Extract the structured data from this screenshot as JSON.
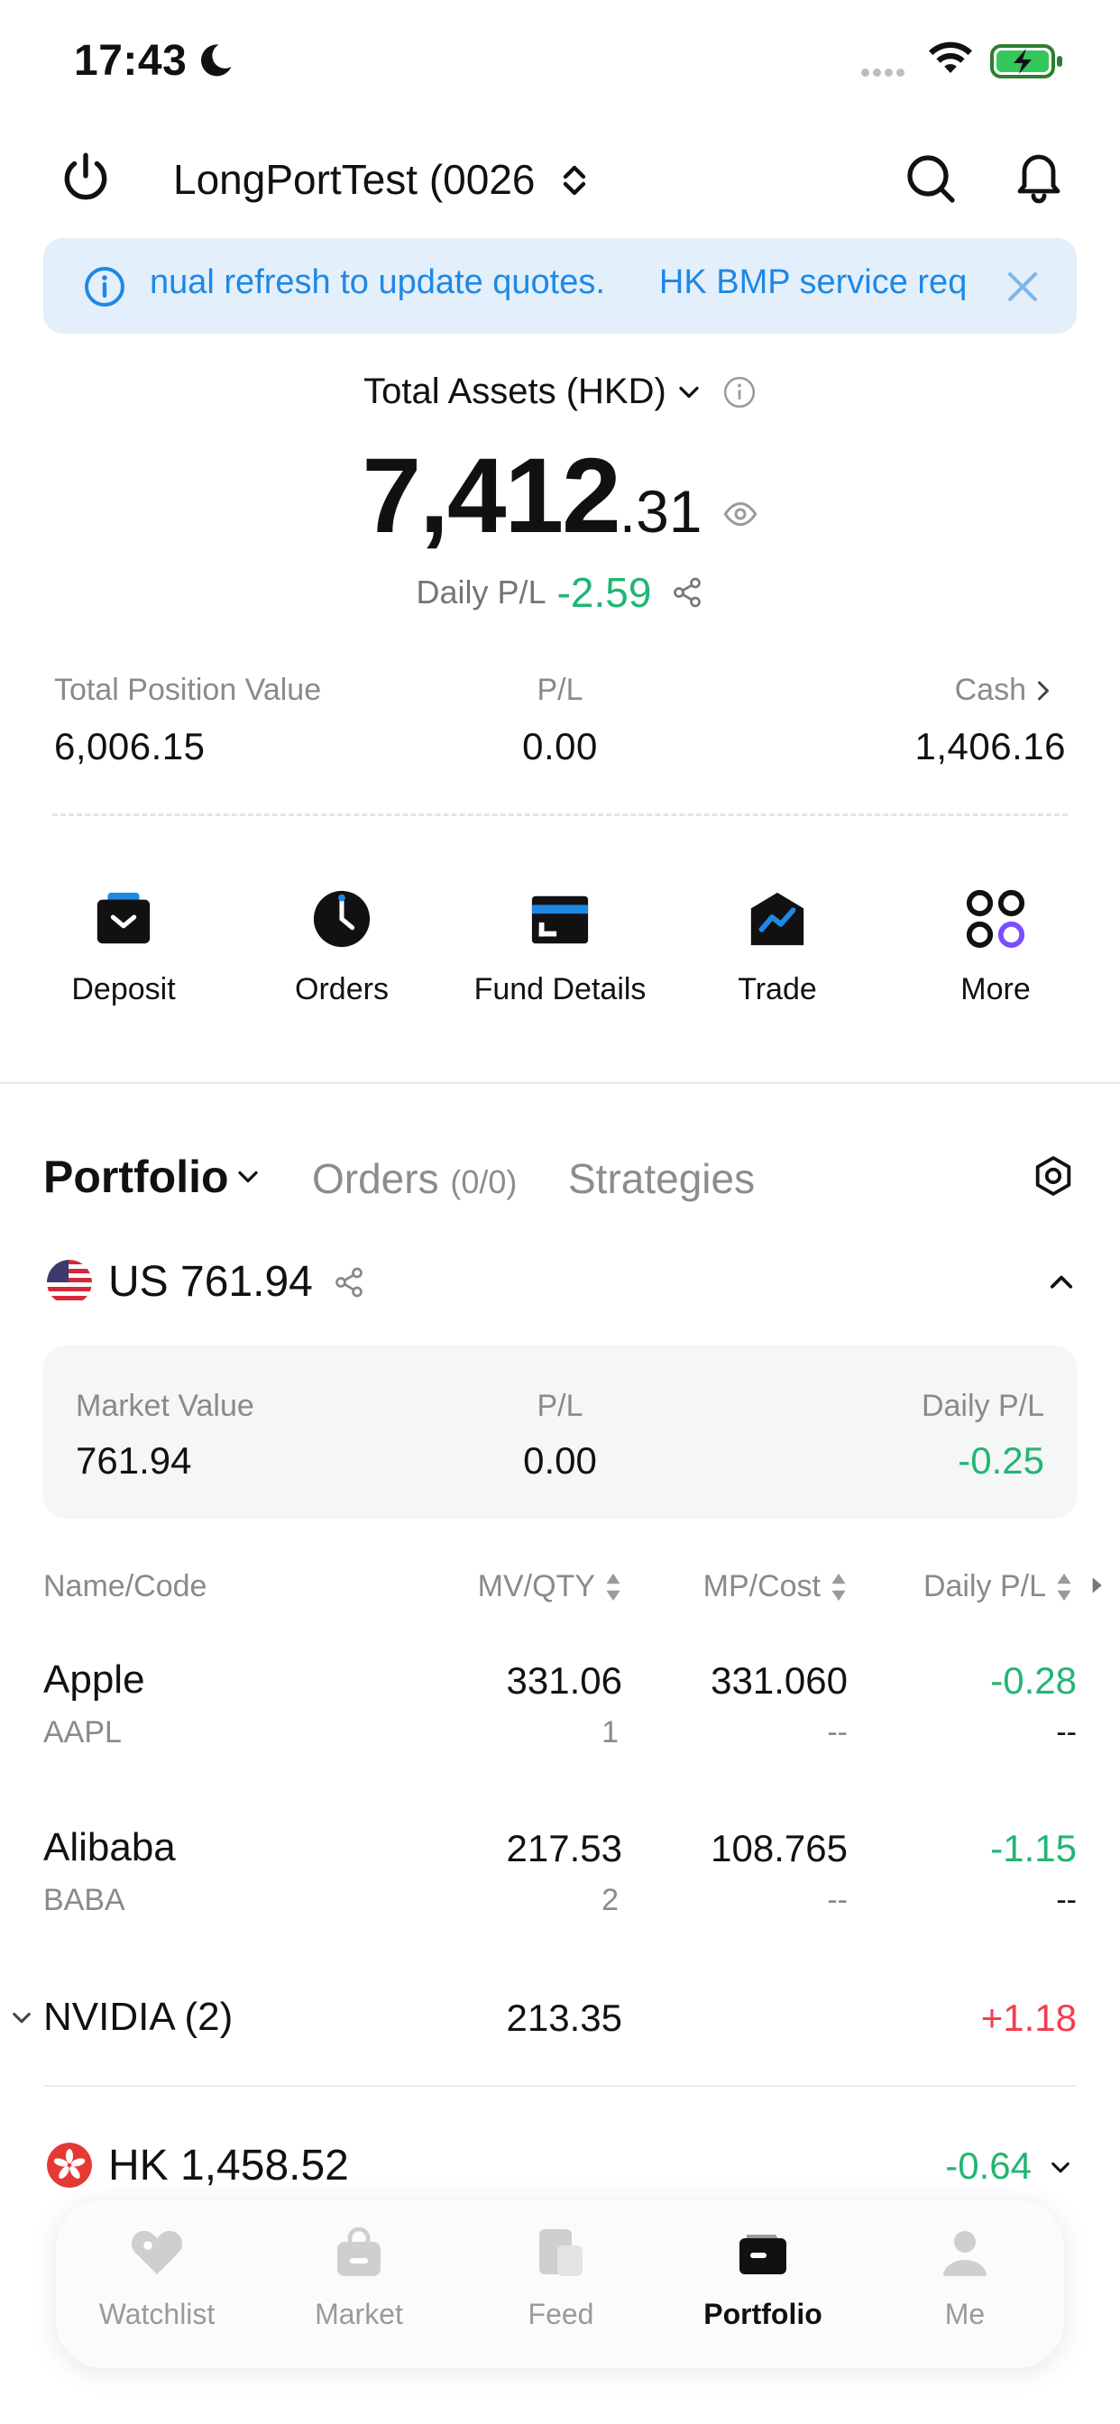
{
  "status_bar": {
    "time": "17:43"
  },
  "header": {
    "account_label": "LongPortTest (0026"
  },
  "banner": {
    "text_1": "nual refresh to update quotes.",
    "text_2": "HK BMP service req"
  },
  "assets": {
    "label": "Total Assets (HKD)",
    "value_int": "7,412",
    "value_dec": ".31",
    "daily_label": "Daily P/L",
    "daily_value": "-2.59"
  },
  "summary": {
    "position_label": "Total Position Value",
    "position_value": "6,006.15",
    "pl_label": "P/L",
    "pl_value": "0.00",
    "cash_label": "Cash",
    "cash_value": "1,406.16"
  },
  "actions": [
    {
      "label": "Deposit"
    },
    {
      "label": "Orders"
    },
    {
      "label": "Fund Details"
    },
    {
      "label": "Trade"
    },
    {
      "label": "More"
    }
  ],
  "tabs": {
    "portfolio": "Portfolio",
    "orders": "Orders",
    "orders_count": "(0/0)",
    "strategies": "Strategies"
  },
  "us_market": {
    "title": "US 761.94",
    "mv_label": "Market Value",
    "mv_value": "761.94",
    "pl_label": "P/L",
    "pl_value": "0.00",
    "daily_label": "Daily P/L",
    "daily_value": "-0.25"
  },
  "table": {
    "headers": {
      "name": "Name/Code",
      "mv_qty": "MV/QTY",
      "mp_cost": "MP/Cost",
      "daily_pl": "Daily P/L"
    },
    "rows": [
      {
        "name": "Apple",
        "code": "AAPL",
        "mv": "331.06",
        "qty": "1",
        "mp": "331.060",
        "cost": "--",
        "daily": "-0.28",
        "daily_sub": "--"
      },
      {
        "name": "Alibaba",
        "code": "BABA",
        "mv": "217.53",
        "qty": "2",
        "mp": "108.765",
        "cost": "--",
        "daily": "-1.15",
        "daily_sub": "--"
      }
    ],
    "group": {
      "name": "NVIDIA (2)",
      "mv": "213.35",
      "daily": "+1.18"
    }
  },
  "hk_market": {
    "title": "HK 1,458.52",
    "daily_value": "-0.64"
  },
  "tabbar": [
    {
      "label": "Watchlist"
    },
    {
      "label": "Market"
    },
    {
      "label": "Feed"
    },
    {
      "label": "Portfolio"
    },
    {
      "label": "Me"
    }
  ],
  "colors": {
    "up": "#f23d4f",
    "down": "#22b573",
    "accent": "#1e88e5",
    "banner_bg": "#e3effa"
  }
}
